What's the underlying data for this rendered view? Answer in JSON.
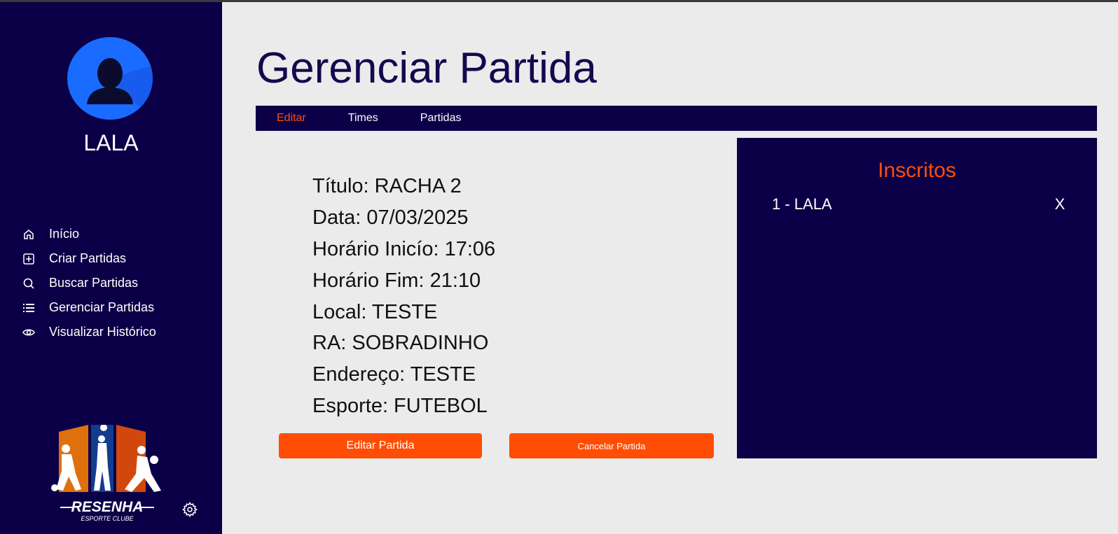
{
  "user": {
    "name": "LALA"
  },
  "nav": {
    "items": [
      {
        "label": "Início",
        "icon": "home-icon"
      },
      {
        "label": "Criar Partidas",
        "icon": "plus-square-icon"
      },
      {
        "label": "Buscar Partidas",
        "icon": "search-icon"
      },
      {
        "label": "Gerenciar Partidas",
        "icon": "list-icon"
      },
      {
        "label": "Visualizar Histórico",
        "icon": "eye-icon"
      }
    ]
  },
  "logo": {
    "title": "RESENHA",
    "subtitle": "ESPORTE CLUBE"
  },
  "page": {
    "title": "Gerenciar Partida"
  },
  "tabs": [
    {
      "label": "Editar",
      "active": true
    },
    {
      "label": "Times",
      "active": false
    },
    {
      "label": "Partidas",
      "active": false
    }
  ],
  "match": {
    "rows": [
      "Título: RACHA 2",
      "Data: 07/03/2025",
      "Horário Inicío: 17:06",
      "Horário Fim: 21:10",
      "Local: TESTE",
      "RA: SOBRADINHO",
      "Endereço: TESTE",
      "Esporte: FUTEBOL"
    ]
  },
  "actions": {
    "edit_label": "Editar Partida",
    "cancel_label": "Cancelar Partida"
  },
  "enrolled": {
    "title": "Inscritos",
    "items": [
      {
        "label": "1 - LALA",
        "remove": "X"
      }
    ]
  },
  "colors": {
    "navy": "#0b0047",
    "accent": "#ff4d05",
    "avatar": "#1a6bff",
    "background": "#ebebeb"
  }
}
